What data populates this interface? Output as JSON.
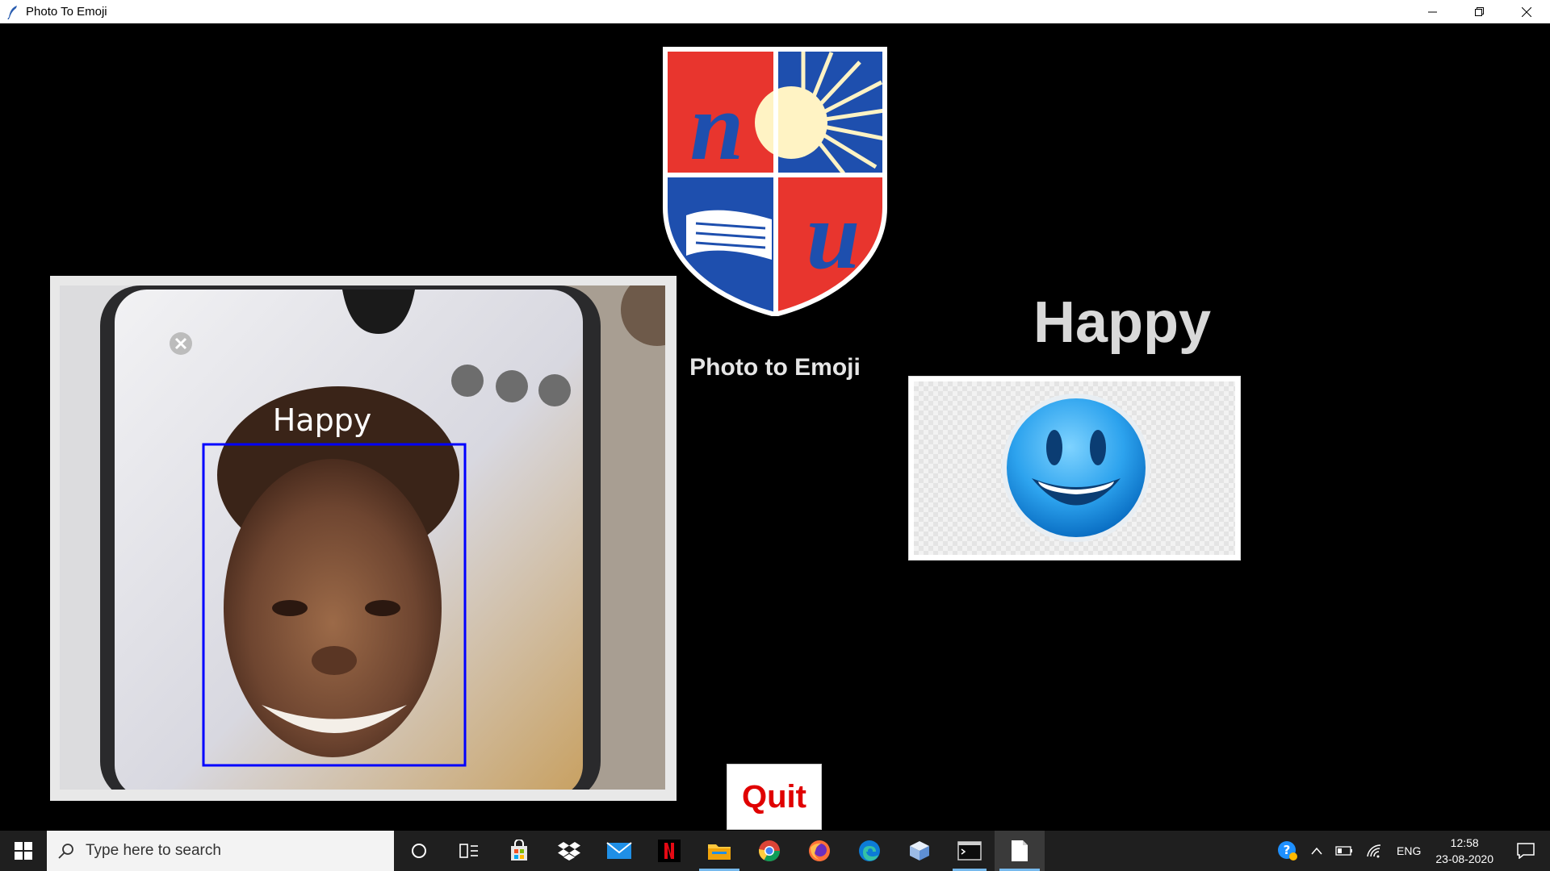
{
  "window": {
    "title": "Photo To Emoji"
  },
  "app": {
    "title": "Photo to Emoji",
    "detected_emotion": "Happy",
    "video_overlay_label": "Happy",
    "quit_label": "Quit",
    "colors": {
      "background": "#000000",
      "heading_text": "#d9d9d9",
      "quit_text": "#e00000",
      "face_box": "#0000ff"
    }
  },
  "logo": {
    "letters": [
      "n",
      "u"
    ],
    "colors": {
      "red": "#e8352e",
      "blue": "#1e4fae",
      "sun": "#fff3c4"
    }
  },
  "taskbar": {
    "search_placeholder": "Type here to search",
    "pinned": [
      "cortana-icon",
      "task-view-icon",
      "store-icon",
      "dropbox-icon",
      "mail-icon",
      "netflix-icon",
      "file-explorer-icon",
      "chrome-icon",
      "firefox-icon",
      "edge-icon",
      "box-app-icon",
      "terminal-icon",
      "notepad-icon"
    ],
    "tray": {
      "language": "ENG",
      "time": "12:58",
      "date": "23-08-2020"
    }
  }
}
